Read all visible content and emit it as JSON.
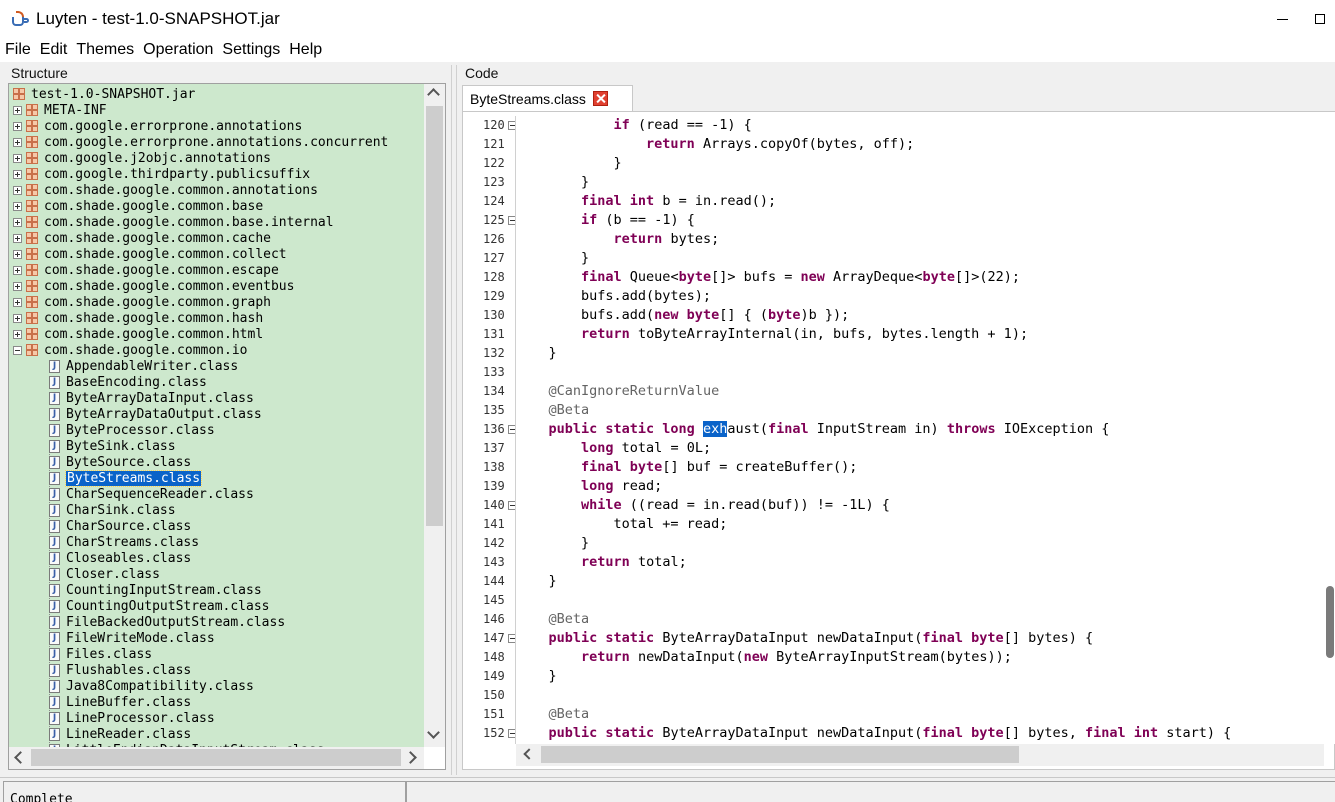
{
  "window": {
    "title": "Luyten - test-1.0-SNAPSHOT.jar"
  },
  "menu": [
    "File",
    "Edit",
    "Themes",
    "Operation",
    "Settings",
    "Help"
  ],
  "structure": {
    "title": "Structure",
    "root": "test-1.0-SNAPSHOT.jar",
    "packages": [
      "META-INF",
      "com.google.errorprone.annotations",
      "com.google.errorprone.annotations.concurrent",
      "com.google.j2objc.annotations",
      "com.google.thirdparty.publicsuffix",
      "com.shade.google.common.annotations",
      "com.shade.google.common.base",
      "com.shade.google.common.base.internal",
      "com.shade.google.common.cache",
      "com.shade.google.common.collect",
      "com.shade.google.common.escape",
      "com.shade.google.common.eventbus",
      "com.shade.google.common.graph",
      "com.shade.google.common.hash",
      "com.shade.google.common.html",
      "com.shade.google.common.io"
    ],
    "expanded_package": "com.shade.google.common.io",
    "classes": [
      "AppendableWriter.class",
      "BaseEncoding.class",
      "ByteArrayDataInput.class",
      "ByteArrayDataOutput.class",
      "ByteProcessor.class",
      "ByteSink.class",
      "ByteSource.class",
      "ByteStreams.class",
      "CharSequenceReader.class",
      "CharSink.class",
      "CharSource.class",
      "CharStreams.class",
      "Closeables.class",
      "Closer.class",
      "CountingInputStream.class",
      "CountingOutputStream.class",
      "FileBackedOutputStream.class",
      "FileWriteMode.class",
      "Files.class",
      "Flushables.class",
      "Java8Compatibility.class",
      "LineBuffer.class",
      "LineProcessor.class",
      "LineReader.class",
      "LittleEndianDataInputStream.class"
    ],
    "selected_class": "ByteStreams.class",
    "class_icon_glyph": "J"
  },
  "code": {
    "title": "Code",
    "tab_label": "ByteStreams.class",
    "lines": [
      {
        "n": "120",
        "fold": true,
        "segs": [
          [
            "",
            "            "
          ],
          [
            "kw",
            "if"
          ],
          [
            "",
            " (read == -1) {"
          ]
        ]
      },
      {
        "n": "121",
        "fold": false,
        "segs": [
          [
            "",
            "                "
          ],
          [
            "kw",
            "return"
          ],
          [
            "",
            " Arrays.copyOf(bytes, off);"
          ]
        ]
      },
      {
        "n": "122",
        "fold": false,
        "segs": [
          [
            "",
            "            }"
          ]
        ]
      },
      {
        "n": "123",
        "fold": false,
        "segs": [
          [
            "",
            "        }"
          ]
        ]
      },
      {
        "n": "124",
        "fold": false,
        "segs": [
          [
            "",
            "        "
          ],
          [
            "kw",
            "final int"
          ],
          [
            "",
            " b = in.read();"
          ]
        ]
      },
      {
        "n": "125",
        "fold": true,
        "segs": [
          [
            "",
            "        "
          ],
          [
            "kw",
            "if"
          ],
          [
            "",
            " (b == -1) {"
          ]
        ]
      },
      {
        "n": "126",
        "fold": false,
        "segs": [
          [
            "",
            "            "
          ],
          [
            "kw",
            "return"
          ],
          [
            "",
            " bytes;"
          ]
        ]
      },
      {
        "n": "127",
        "fold": false,
        "segs": [
          [
            "",
            "        }"
          ]
        ]
      },
      {
        "n": "128",
        "fold": false,
        "segs": [
          [
            "",
            "        "
          ],
          [
            "kw",
            "final"
          ],
          [
            "",
            " Queue<"
          ],
          [
            "kw",
            "byte"
          ],
          [
            "",
            "[]> bufs = "
          ],
          [
            "kw",
            "new"
          ],
          [
            "",
            " ArrayDeque<"
          ],
          [
            "kw",
            "byte"
          ],
          [
            "",
            "[]>(22);"
          ]
        ]
      },
      {
        "n": "129",
        "fold": false,
        "segs": [
          [
            "",
            "        bufs.add(bytes);"
          ]
        ]
      },
      {
        "n": "130",
        "fold": false,
        "segs": [
          [
            "",
            "        bufs.add("
          ],
          [
            "kw",
            "new byte"
          ],
          [
            "",
            "[] { ("
          ],
          [
            "kw",
            "byte"
          ],
          [
            "",
            ")b });"
          ]
        ]
      },
      {
        "n": "131",
        "fold": false,
        "segs": [
          [
            "",
            "        "
          ],
          [
            "kw",
            "return"
          ],
          [
            "",
            " toByteArrayInternal(in, bufs, bytes.length + 1);"
          ]
        ]
      },
      {
        "n": "132",
        "fold": false,
        "segs": [
          [
            "",
            "    }"
          ]
        ]
      },
      {
        "n": "133",
        "fold": false,
        "segs": [
          [
            "",
            ""
          ]
        ]
      },
      {
        "n": "134",
        "fold": false,
        "segs": [
          [
            "",
            "    "
          ],
          [
            "ann",
            "@CanIgnoreReturnValue"
          ]
        ]
      },
      {
        "n": "135",
        "fold": false,
        "segs": [
          [
            "",
            "    "
          ],
          [
            "ann",
            "@Beta"
          ]
        ]
      },
      {
        "n": "136",
        "fold": true,
        "segs": [
          [
            "",
            "    "
          ],
          [
            "kw",
            "public static long"
          ],
          [
            "",
            " "
          ],
          [
            "hl",
            "exh"
          ],
          [
            "",
            "aust("
          ],
          [
            "kw",
            "final"
          ],
          [
            "",
            " InputStream in) "
          ],
          [
            "kw",
            "throws"
          ],
          [
            "",
            " IOException {"
          ]
        ]
      },
      {
        "n": "137",
        "fold": false,
        "segs": [
          [
            "",
            "        "
          ],
          [
            "kw",
            "long"
          ],
          [
            "",
            " total = 0L;"
          ]
        ]
      },
      {
        "n": "138",
        "fold": false,
        "segs": [
          [
            "",
            "        "
          ],
          [
            "kw",
            "final byte"
          ],
          [
            "",
            "[] buf = createBuffer();"
          ]
        ]
      },
      {
        "n": "139",
        "fold": false,
        "segs": [
          [
            "",
            "        "
          ],
          [
            "kw",
            "long"
          ],
          [
            "",
            " read;"
          ]
        ]
      },
      {
        "n": "140",
        "fold": true,
        "segs": [
          [
            "",
            "        "
          ],
          [
            "kw",
            "while"
          ],
          [
            "",
            " ((read = in.read(buf)) != -1L) {"
          ]
        ]
      },
      {
        "n": "141",
        "fold": false,
        "segs": [
          [
            "",
            "            total += read;"
          ]
        ]
      },
      {
        "n": "142",
        "fold": false,
        "segs": [
          [
            "",
            "        }"
          ]
        ]
      },
      {
        "n": "143",
        "fold": false,
        "segs": [
          [
            "",
            "        "
          ],
          [
            "kw",
            "return"
          ],
          [
            "",
            " total;"
          ]
        ]
      },
      {
        "n": "144",
        "fold": false,
        "segs": [
          [
            "",
            "    }"
          ]
        ]
      },
      {
        "n": "145",
        "fold": false,
        "segs": [
          [
            "",
            ""
          ]
        ]
      },
      {
        "n": "146",
        "fold": false,
        "segs": [
          [
            "",
            "    "
          ],
          [
            "ann",
            "@Beta"
          ]
        ]
      },
      {
        "n": "147",
        "fold": true,
        "segs": [
          [
            "",
            "    "
          ],
          [
            "kw",
            "public static"
          ],
          [
            "",
            " ByteArrayDataInput newDataInput("
          ],
          [
            "kw",
            "final byte"
          ],
          [
            "",
            "[] bytes) {"
          ]
        ]
      },
      {
        "n": "148",
        "fold": false,
        "segs": [
          [
            "",
            "        "
          ],
          [
            "kw",
            "return"
          ],
          [
            "",
            " newDataInput("
          ],
          [
            "kw",
            "new"
          ],
          [
            "",
            " ByteArrayInputStream(bytes));"
          ]
        ]
      },
      {
        "n": "149",
        "fold": false,
        "segs": [
          [
            "",
            "    }"
          ]
        ]
      },
      {
        "n": "150",
        "fold": false,
        "segs": [
          [
            "",
            ""
          ]
        ]
      },
      {
        "n": "151",
        "fold": false,
        "segs": [
          [
            "",
            "    "
          ],
          [
            "ann",
            "@Beta"
          ]
        ]
      },
      {
        "n": "152",
        "fold": true,
        "segs": [
          [
            "",
            "    "
          ],
          [
            "kw",
            "public static"
          ],
          [
            "",
            " ByteArrayDataInput newDataInput("
          ],
          [
            "kw",
            "final byte"
          ],
          [
            "",
            "[] bytes, "
          ],
          [
            "kw",
            "final int"
          ],
          [
            "",
            " start) {"
          ]
        ]
      }
    ]
  },
  "status": {
    "text": "Complete"
  },
  "colors": {
    "tree_bg": "#cde8cd",
    "keyword": "#7f0055",
    "annotation": "#646464",
    "selection": "#0a63c9"
  }
}
